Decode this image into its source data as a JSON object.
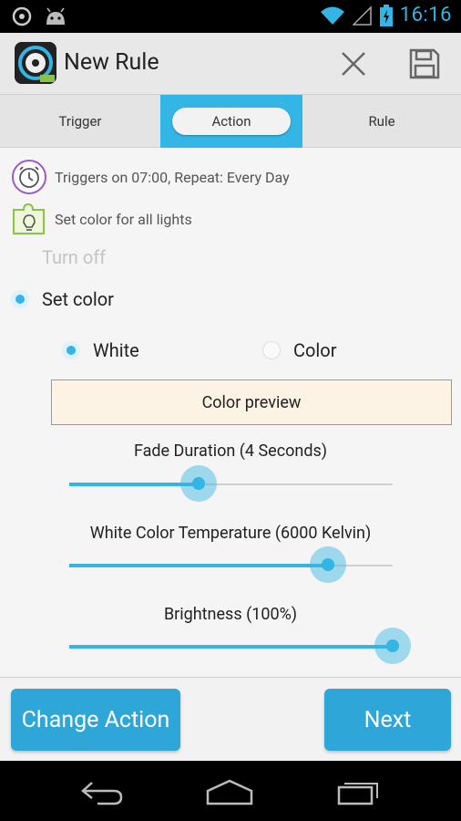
{
  "statusbar": {
    "time": "16:16"
  },
  "actionbar": {
    "title": "New Rule"
  },
  "tabs": [
    {
      "label": "Trigger"
    },
    {
      "label": "Action"
    },
    {
      "label": "Rule"
    }
  ],
  "info": {
    "trigger_text": "Triggers on 07:00, Repeat: Every Day",
    "action_text": "Set color for all lights"
  },
  "options": {
    "turn_off_label": "Turn off",
    "set_color_label": "Set color",
    "set_color_selected": true,
    "white_label": "White",
    "color_label": "Color",
    "white_selected": true
  },
  "preview": {
    "label": "Color preview",
    "color": "#fdf3e4"
  },
  "sliders": {
    "fade": {
      "label": "Fade Duration (4 Seconds)",
      "value_fraction": 0.4
    },
    "temperature": {
      "label": "White Color Temperature (6000 Kelvin)",
      "value_fraction": 0.8
    },
    "brightness": {
      "label": "Brightness (100%)",
      "value_fraction": 1.0
    }
  },
  "buttons": {
    "change_action": "Change Action",
    "next": "Next"
  },
  "colors": {
    "accent": "#33b5e5",
    "button": "#2ea6d8"
  }
}
